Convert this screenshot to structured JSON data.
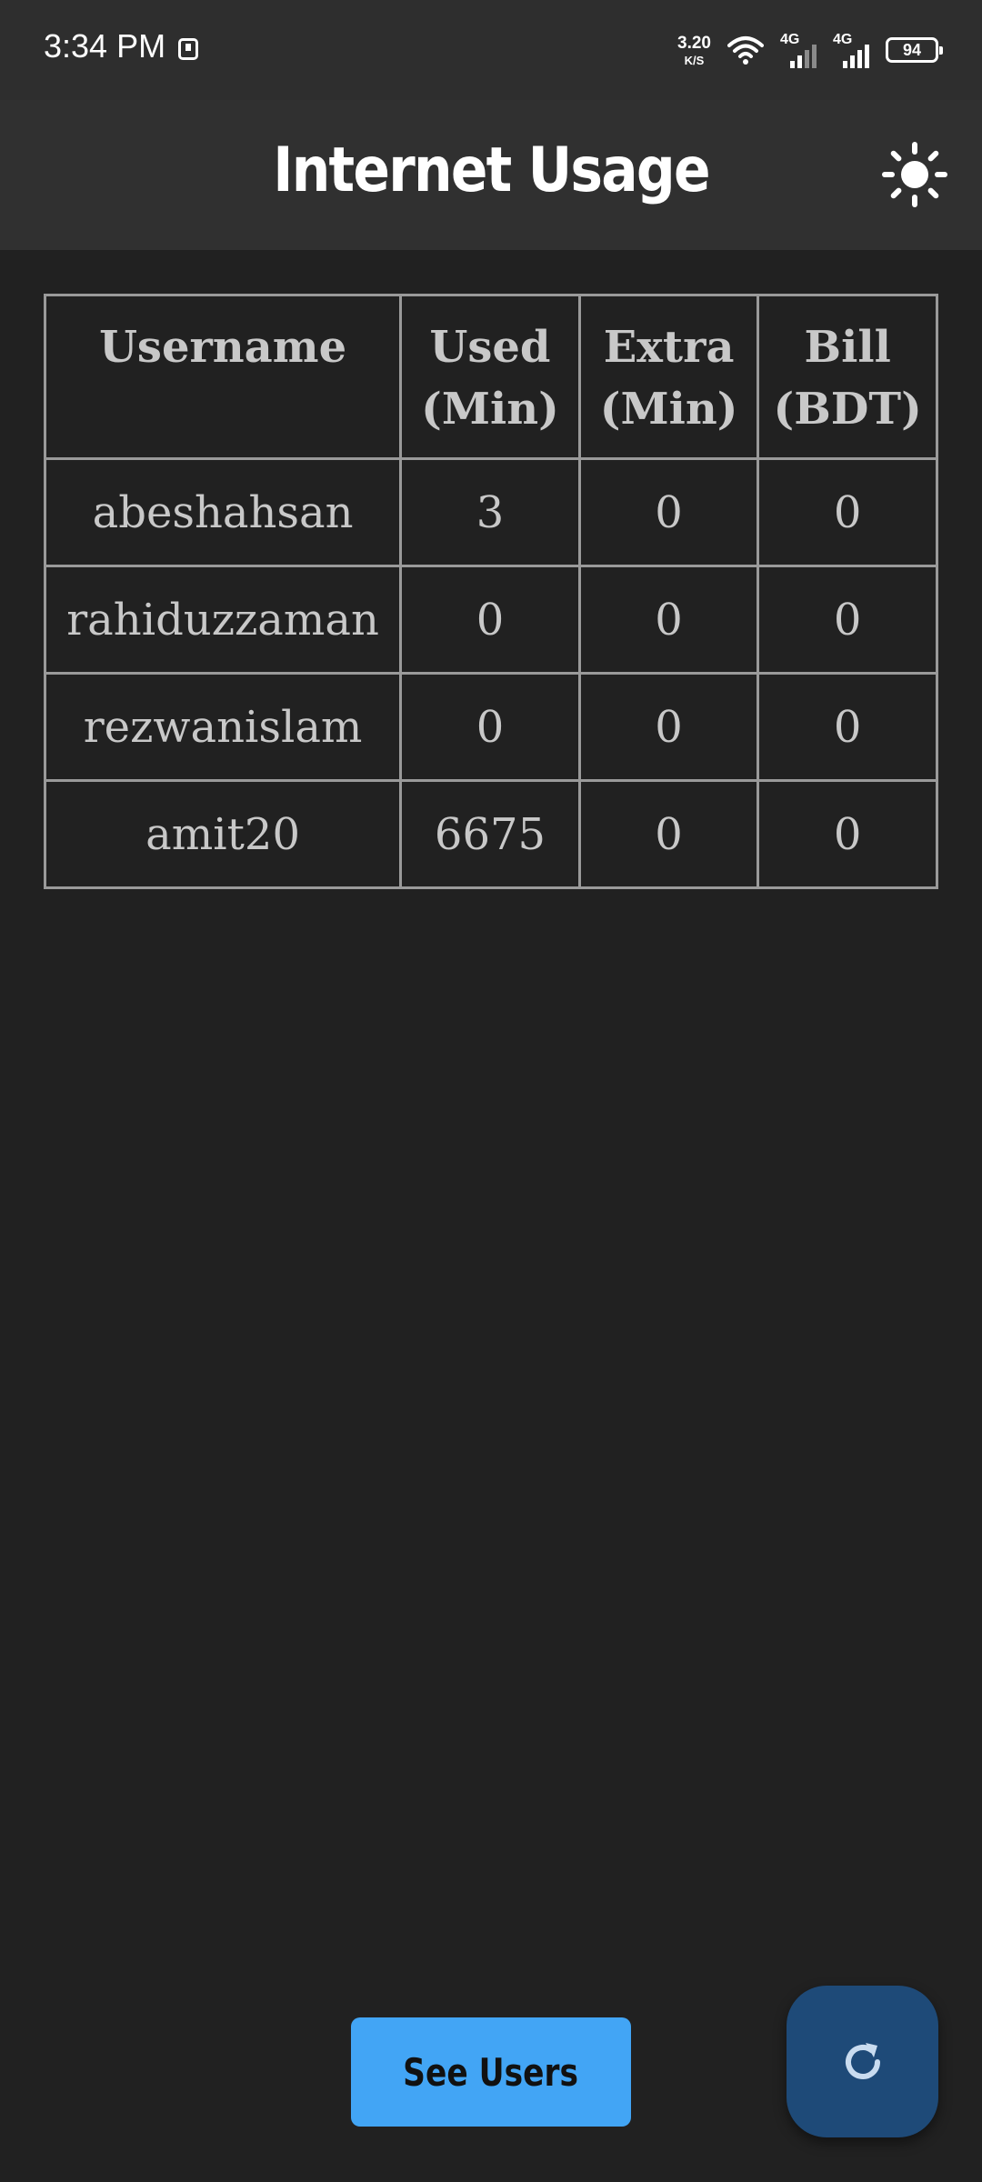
{
  "status_bar": {
    "time": "3:34 PM",
    "net_speed_value": "3.20",
    "net_speed_unit": "K/S",
    "sim1_label": "4G",
    "sim2_label": "4G",
    "battery": "94"
  },
  "app_bar": {
    "title": "Internet Usage",
    "theme_icon": "sun-icon"
  },
  "table": {
    "headers": [
      {
        "line1": "Username",
        "line2": ""
      },
      {
        "line1": "Used",
        "line2": "(Min)"
      },
      {
        "line1": "Extra",
        "line2": "(Min)"
      },
      {
        "line1": "Bill",
        "line2": "(BDT)"
      }
    ],
    "rows": [
      {
        "username": "abeshahsan",
        "used": "3",
        "extra": "0",
        "bill": "0"
      },
      {
        "username": "rahiduzzaman",
        "used": "0",
        "extra": "0",
        "bill": "0"
      },
      {
        "username": "rezwanislam",
        "used": "0",
        "extra": "0",
        "bill": "0"
      },
      {
        "username": "amit20",
        "used": "6675",
        "extra": "0",
        "bill": "0"
      }
    ]
  },
  "actions": {
    "see_users_label": "See Users",
    "refresh_icon": "refresh-icon"
  },
  "colors": {
    "background": "#212121",
    "app_bar": "#303030",
    "primary_button": "#42a5f5",
    "fab": "#1e4a78"
  }
}
